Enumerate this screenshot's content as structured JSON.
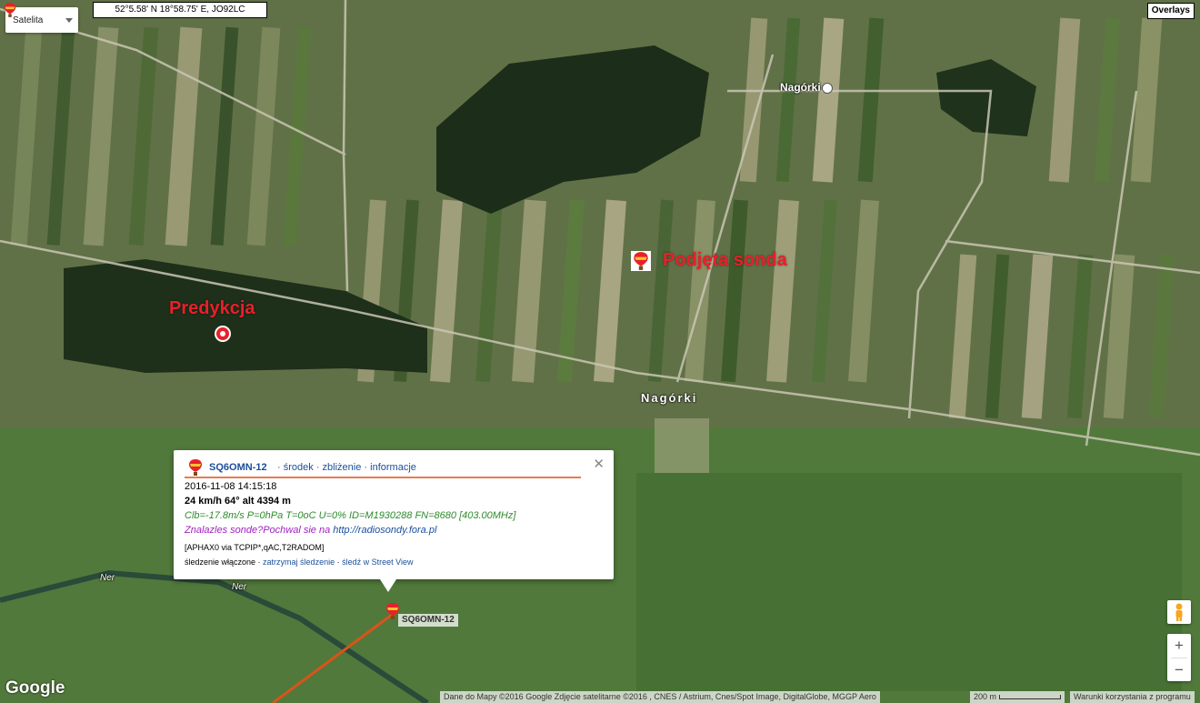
{
  "colors": {
    "annotation": "#e8202a",
    "popup_accent": "#e77b52",
    "link": "#1a4e9c",
    "status_green": "#2e8b2e",
    "promo_purple": "#a020c0",
    "track_line": "#d9541a"
  },
  "map_type": {
    "label": "Satelita"
  },
  "coords": {
    "text": "52°5.58' N 18°58.75' E, JO92LC"
  },
  "overlays": {
    "label": "Overlays"
  },
  "annotations": {
    "prediction": "Predykcja",
    "picked_up": "Podjęta sonda"
  },
  "places": {
    "nagorki_top": "Nagórki",
    "nagorki_mid": "Nagórki",
    "river_1": "Ner",
    "river_2": "Ner"
  },
  "popup": {
    "callsign": "SQ6OMN-12",
    "link_center": "środek",
    "link_zoom": "zbliżenie",
    "link_info": "informacje",
    "sep": " · ",
    "timestamp": "2016-11-08 14:15:18",
    "motion": "24 km/h 64° alt 4394 m",
    "telemetry": "Clb=-17.8m/s P=0hPa T=0oC U=0% ID=M1930288 FN=8680 [403.00MHz]",
    "promo_text": "Znalazles sonde?Pochwal sie na ",
    "promo_url": "http://radiosondy.fora.pl",
    "path": "[APHAX0 via TCPIP*,qAC,T2RADOM]",
    "tracking_status": "śledzenie włączone",
    "stop_tracking": "zatrzymaj śledzenie",
    "street_view": "śledź w Street View"
  },
  "marker_label": "SQ6OMN-12",
  "icons": [
    "balloon-icon",
    "prediction-target-icon",
    "close-icon",
    "pegman-icon",
    "zoom-in-icon",
    "zoom-out-icon",
    "place-marker-icon"
  ],
  "zoom": {
    "in": "+",
    "out": "−"
  },
  "footer": {
    "attribution": "Dane do Mapy ©2016 Google Zdjęcie satelitarne ©2016 , CNES / Astrium, Cnes/Spot Image, DigitalGlobe, MGGP Aero",
    "scale": "200 m",
    "terms": "Warunki korzystania z programu"
  },
  "google_logo": "Google"
}
